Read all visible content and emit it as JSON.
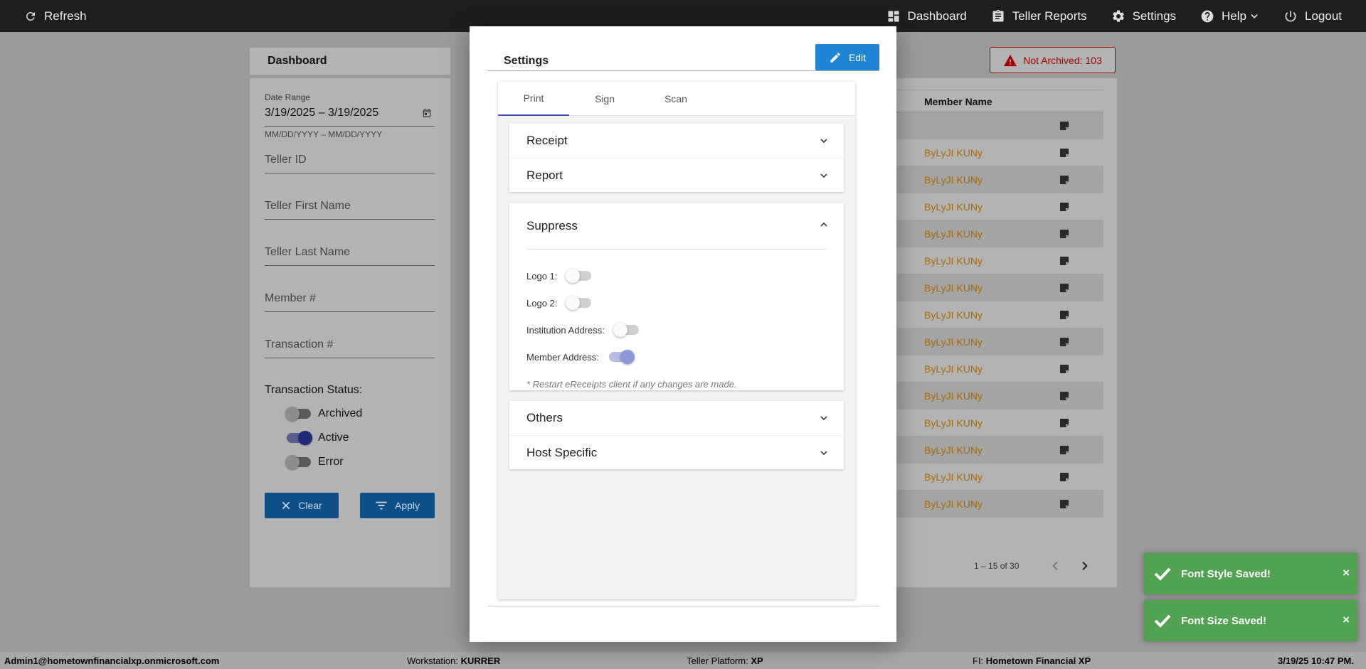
{
  "topbar": {
    "refresh_label": "Refresh",
    "nav": [
      {
        "label": "Dashboard",
        "icon": "dashboard-icon"
      },
      {
        "label": "Teller Reports",
        "icon": "clipboard-icon"
      },
      {
        "label": "Settings",
        "icon": "gear-icon"
      },
      {
        "label": "Help",
        "icon": "help-icon"
      },
      {
        "label": "Logout",
        "icon": "power-icon"
      }
    ]
  },
  "dashboard": {
    "title": "Dashboard",
    "filters": {
      "date_range_label": "Date Range",
      "date_range_value": "3/19/2025 – 3/19/2025",
      "date_hint": "MM/DD/YYYY – MM/DD/YYYY",
      "teller_id": "Teller ID",
      "teller_first_name": "Teller First Name",
      "teller_last_name": "Teller Last Name",
      "member_number": "Member #",
      "transaction_number": "Transaction #",
      "status_label": "Transaction Status:",
      "statuses": [
        {
          "label": "Archived",
          "on": false
        },
        {
          "label": "Active",
          "on": true
        },
        {
          "label": "Error",
          "on": false
        }
      ],
      "clear_label": "Clear",
      "apply_label": "Apply"
    },
    "not_archived": "Not Archived: 103",
    "grid": {
      "column_member_name": "Member Name",
      "rows": [
        "",
        "ByLyJI KUNy",
        "ByLyJI KUNy",
        "ByLyJI KUNy",
        "ByLyJI KUNy",
        "ByLyJI KUNy",
        "ByLyJI KUNy",
        "ByLyJI KUNy",
        "ByLyJI KUNy",
        "ByLyJI KUNy",
        "ByLyJI KUNy",
        "ByLyJI KUNy",
        "ByLyJI KUNy",
        "ByLyJI KUNy",
        "ByLyJI KUNy"
      ]
    },
    "pager": "1 – 15 of 30"
  },
  "modal": {
    "title": "Settings",
    "edit_label": "Edit",
    "tabs": [
      "Print",
      "Sign",
      "Scan"
    ],
    "active_tab": "Print",
    "sections_top": [
      "Receipt",
      "Report"
    ],
    "suppress": {
      "title": "Suppress",
      "toggles": [
        {
          "label": "Logo 1:",
          "on": false
        },
        {
          "label": "Logo 2:",
          "on": false
        },
        {
          "label": "Institution Address:",
          "on": false
        },
        {
          "label": "Member Address:",
          "on": true
        }
      ],
      "note": "* Restart eReceipts client if any changes are made."
    },
    "sections_bottom": [
      "Others",
      "Host Specific"
    ]
  },
  "toasts": [
    {
      "message": "Font Style Saved!",
      "color": "#51a351"
    },
    {
      "message": "Font Size Saved!",
      "color": "#51a351"
    }
  ],
  "footer": {
    "user": "Admin1@hometownfinancialxp.onmicrosoft.com",
    "workstation_label": "Workstation:",
    "workstation": "KURRER",
    "platform_label": "Teller Platform:",
    "platform": "XP",
    "fi_label": "FI:",
    "fi": "Hometown Financial XP",
    "datetime": "3/19/25 10:47 PM."
  }
}
